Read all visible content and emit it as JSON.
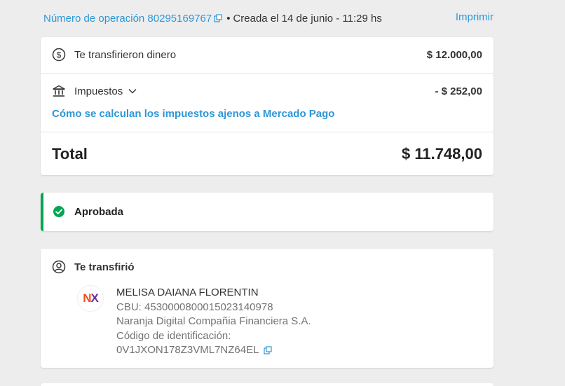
{
  "header": {
    "operation_label": "Número de operación 80295169767",
    "separator": "•",
    "created": "Creada el 14 de junio - 11:29 hs",
    "print_label": "Imprimir"
  },
  "summary": {
    "received_label": "Te transfirieron dinero",
    "received_amount": "$ 12.000,00",
    "taxes_label": "Impuestos",
    "taxes_amount": "- $ 252,00",
    "taxes_link": "Cómo se calculan los impuestos ajenos a Mercado Pago",
    "total_label": "Total",
    "total_amount": "$ 11.748,00"
  },
  "status": {
    "label": "Aprobada",
    "color": "#00a650"
  },
  "sender": {
    "title": "Te transfirió",
    "logo_text_n": "N",
    "logo_text_x": "X",
    "name": "MELISA DAIANA FLORENTIN",
    "cbu": "CBU: 4530000800015023140978",
    "bank": "Naranja Digital Compañia Financiera S.A.",
    "id_label": "Código de identificación:",
    "id_value": "0V1JXON178Z3VML7NZ64EL"
  },
  "colors": {
    "link": "#2d97d8",
    "background": "#ededed"
  }
}
